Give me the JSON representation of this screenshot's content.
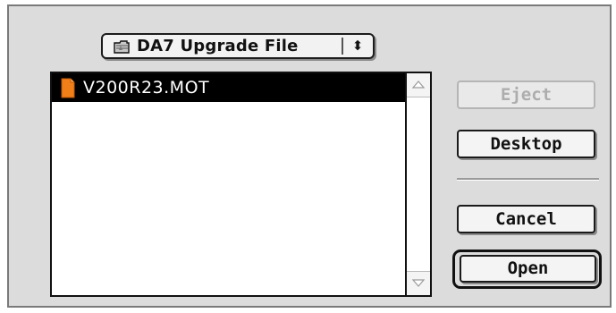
{
  "dialog": {
    "folder_popup": {
      "label": "DA7 Upgrade File",
      "icon": "folder-icon",
      "arrows": "⬍"
    },
    "file_list": {
      "items": [
        {
          "name": "V200R23.MOT",
          "icon": "document-icon",
          "selected": true
        }
      ]
    },
    "buttons": {
      "eject": "Eject",
      "desktop": "Desktop",
      "cancel": "Cancel",
      "open": "Open"
    },
    "colors": {
      "selection": "#000000",
      "file_icon": "#f07f1a",
      "dialog_bg": "#dcdcdc"
    }
  }
}
